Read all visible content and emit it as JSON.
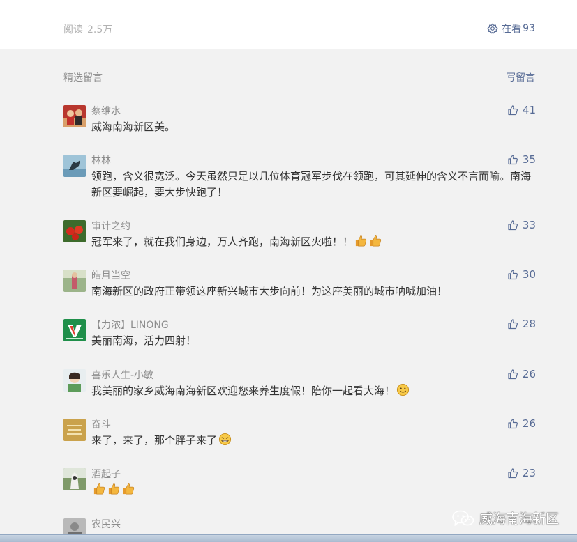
{
  "header": {
    "read_label": "阅读",
    "read_count": "2.5万",
    "watching_label": "在看",
    "watching_count": "93"
  },
  "comments_section": {
    "title": "精选留言",
    "write_label": "写留言"
  },
  "comments": [
    {
      "name": "蔡维水",
      "text": "威海南海新区美。",
      "likes": "41",
      "emoji": ""
    },
    {
      "name": "林林",
      "text": "领跑，含义很宽泛。今天虽然只是以几位体育冠军步伐在领跑，可其延伸的含义不言而喻。南海新区要崛起，要大步快跑了！",
      "likes": "35",
      "emoji": ""
    },
    {
      "name": "审计之约",
      "text": "冠军来了，就在我们身边，万人齐跑，南海新区火啦！！",
      "likes": "33",
      "emoji": "thumbs-up-icon x2"
    },
    {
      "name": "皓月当空",
      "text": "南海新区的政府正带领这座新兴城市大步向前！为这座美丽的城市呐喊加油！",
      "likes": "30",
      "emoji": ""
    },
    {
      "name": "【力浓】LINONG",
      "text": "美丽南海，活力四射！",
      "likes": "28",
      "emoji": ""
    },
    {
      "name": "喜乐人生-小敏",
      "text": "我美丽的家乡威海南海新区欢迎您来养生度假！陪你一起看大海！",
      "likes": "26",
      "emoji": "smile-icon"
    },
    {
      "name": "奋斗",
      "text": "来了，来了，那个胖子来了",
      "likes": "26",
      "emoji": "grin-icon"
    },
    {
      "name": "酒起子",
      "text": "",
      "likes": "23",
      "emoji": "thumbs-up-icon x3"
    },
    {
      "name": "农民兴",
      "text": "",
      "likes": "",
      "emoji": ""
    }
  ],
  "watermark": {
    "text": "威海南海新区",
    "icon": "wechat-icon"
  },
  "colors": {
    "link_blue": "#576b95",
    "meta_gray": "#8c8c8c",
    "body_text": "#333333",
    "background": "#f2f2f2"
  }
}
